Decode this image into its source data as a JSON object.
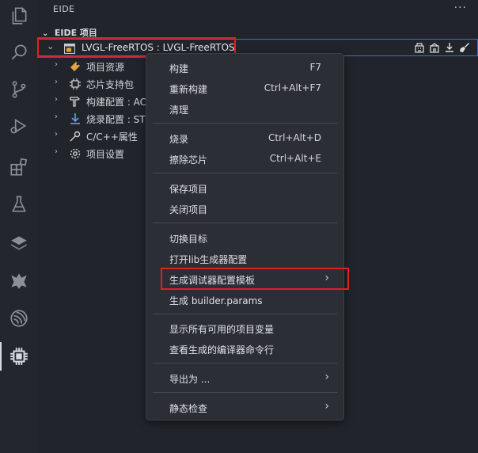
{
  "activity_bar": {
    "icons": [
      "files-icon",
      "search-icon",
      "source-control-icon",
      "run-debug-icon",
      "extensions-icon",
      "testing-icon",
      "layers-icon",
      "wolf-icon",
      "espressif-icon",
      "eide-chip-icon"
    ]
  },
  "panel": {
    "title": "EIDE",
    "more": "···",
    "section": "EIDE 项目",
    "project": "LVGL-FreeRTOS : LVGL-FreeRTOS",
    "tree_items": [
      {
        "label": "项目资源"
      },
      {
        "label": "芯片支持包"
      },
      {
        "label": "构建配置 : AC"
      },
      {
        "label": "烧录配置 : ST"
      },
      {
        "label": "C/C++属性"
      },
      {
        "label": "项目设置"
      }
    ]
  },
  "menu": {
    "items": [
      {
        "label": "构建",
        "key": "F7"
      },
      {
        "label": "重新构建",
        "key": "Ctrl+Alt+F7"
      },
      {
        "label": "清理",
        "key": ""
      },
      {
        "label": "烧录",
        "key": "Ctrl+Alt+D"
      },
      {
        "label": "擦除芯片",
        "key": "Ctrl+Alt+E"
      },
      {
        "label": "保存项目",
        "key": ""
      },
      {
        "label": "关闭项目",
        "key": ""
      },
      {
        "label": "切换目标",
        "key": ""
      },
      {
        "label": "打开lib生成器配置",
        "key": ""
      },
      {
        "label": "生成调试器配置模板",
        "key": "",
        "submenu": true
      },
      {
        "label": "生成 builder.params",
        "key": ""
      },
      {
        "label": "显示所有可用的项目变量",
        "key": ""
      },
      {
        "label": "查看生成的编译器命令行",
        "key": ""
      },
      {
        "label": "导出为 ...",
        "key": "",
        "submenu": true
      },
      {
        "label": "静态检查",
        "key": "",
        "submenu": true
      }
    ],
    "arrow": "›"
  },
  "colors": {
    "highlight_box": "#e02020",
    "selection_border": "#3a70c8",
    "menu_bg": "#2b2e35"
  }
}
